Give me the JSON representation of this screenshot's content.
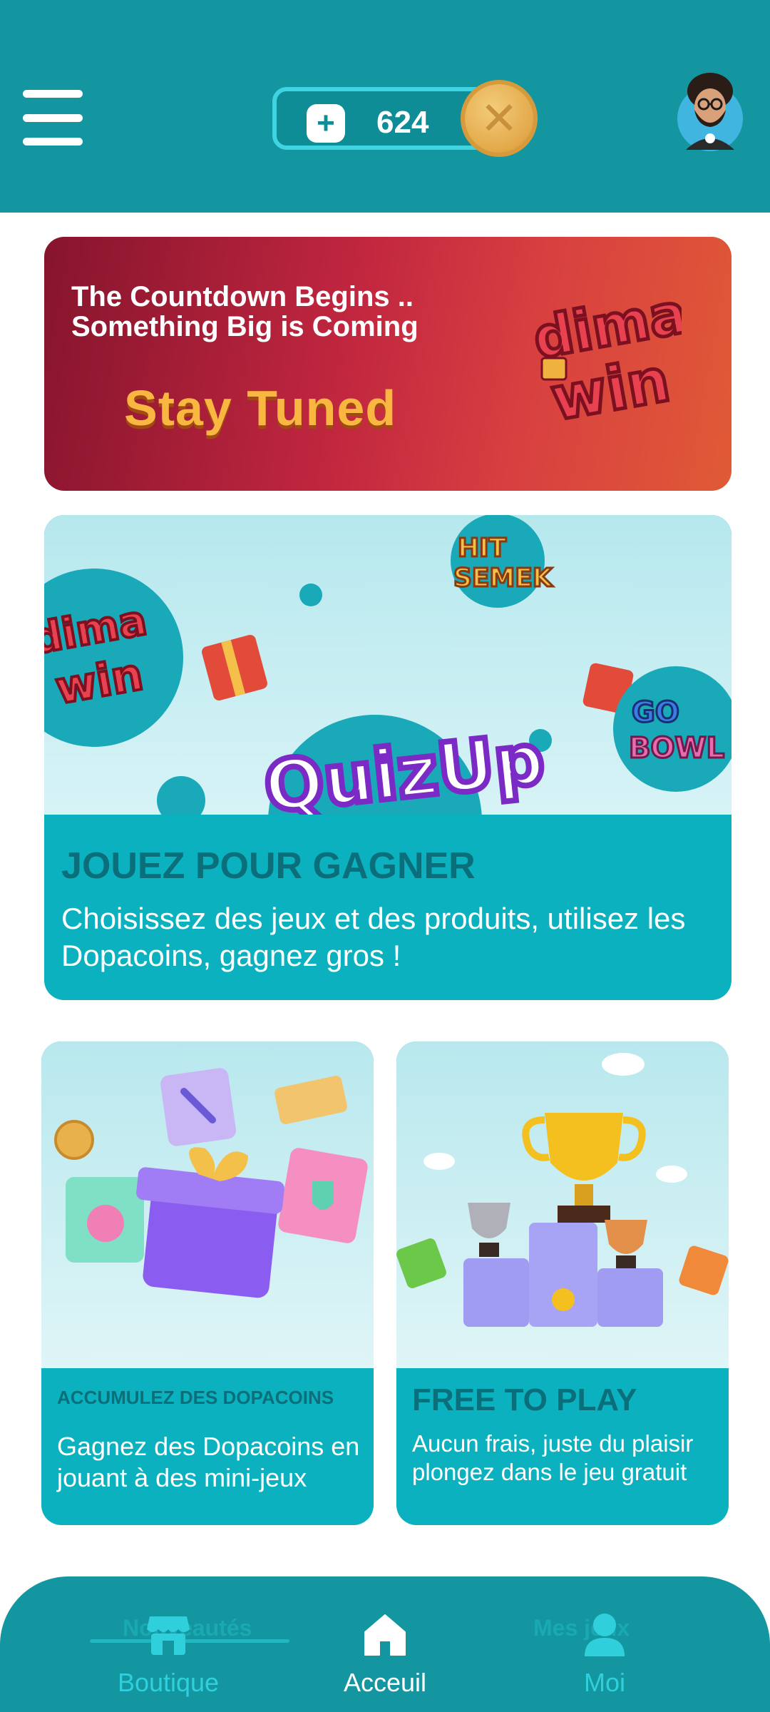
{
  "header": {
    "menu_icon": "hamburger-menu-icon",
    "coin_balance": "624",
    "add_coins_icon": "plus-icon",
    "coin_icon": "dopacoin-icon",
    "avatar_icon": "user-avatar",
    "bg_color": "#13969f"
  },
  "banner": {
    "line1": "The Countdown Begins ..",
    "line2": "Something Big is Coming",
    "cta": "Stay Tuned",
    "logo_text": "dima win"
  },
  "play_card": {
    "title": "JOUEZ POUR GAGNER",
    "description": "Choisissez des jeux et des produits, utilisez les Dopacoins, gagnez gros !",
    "games": [
      "dima win",
      "HIT SEMEK",
      "QuizUp",
      "GO BOWL"
    ]
  },
  "cards": [
    {
      "title": "ACCUMULEZ DES DOPACOINS",
      "description": "Gagnez des Dopacoins en jouant à des mini-jeux"
    },
    {
      "title": "FREE TO PLAY",
      "description": "Aucun frais, juste du plaisir plongez dans le jeu gratuit"
    }
  ],
  "bottom_nav": {
    "ghost_left": "Nouveautés",
    "ghost_right": "Mes jeux",
    "items": [
      {
        "label": "Boutique",
        "icon": "shop-icon",
        "active": false
      },
      {
        "label": "Acceuil",
        "icon": "home-icon",
        "active": true
      },
      {
        "label": "Moi",
        "icon": "user-icon",
        "active": false
      }
    ]
  },
  "colors": {
    "primary": "#13969f",
    "card": "#0cb1bf",
    "card_title": "#0a6f7a",
    "cta": "#f9b640"
  }
}
